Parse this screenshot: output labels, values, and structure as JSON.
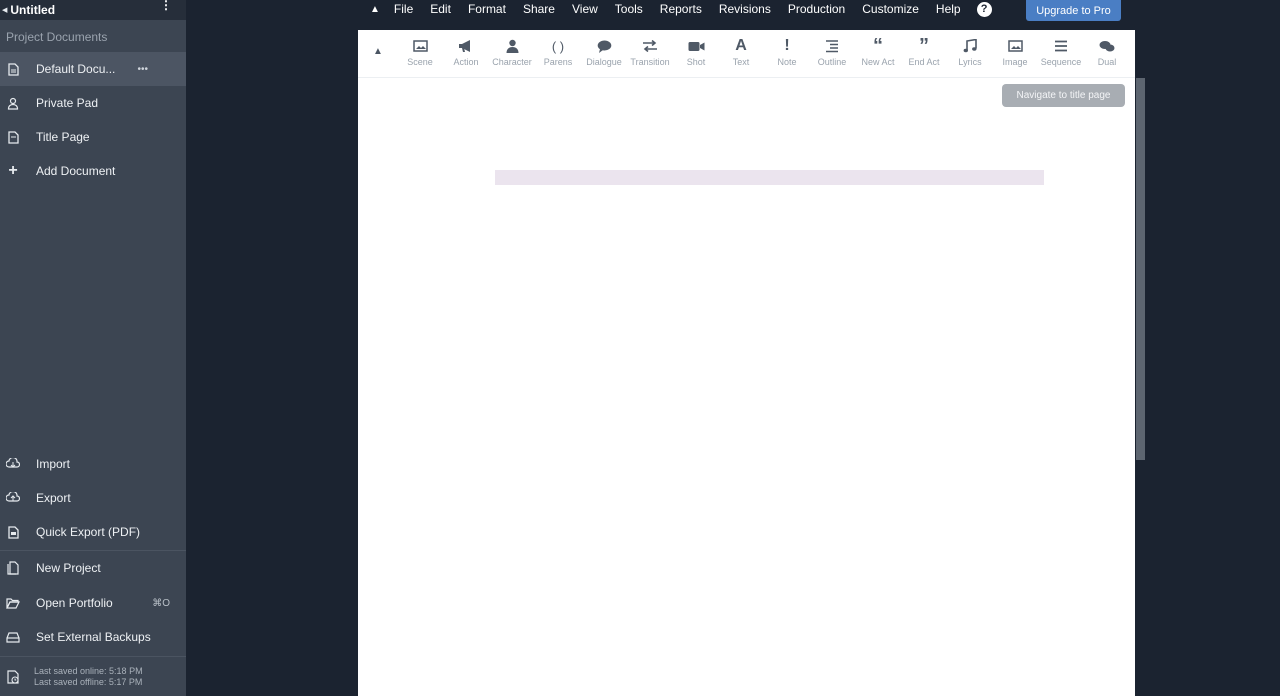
{
  "sidebar": {
    "project_title": "Untitled",
    "section_label": "Project Documents",
    "documents": [
      {
        "label": "Default Docu...",
        "icon": "document-icon",
        "extra": "•••",
        "active": true
      },
      {
        "label": "Private Pad",
        "icon": "private-pad-icon"
      },
      {
        "label": "Title Page",
        "icon": "title-page-icon"
      },
      {
        "label": "Add Document",
        "icon": "plus-icon"
      }
    ],
    "actions": [
      {
        "label": "Import",
        "icon": "import-icon"
      },
      {
        "label": "Export",
        "icon": "export-icon"
      },
      {
        "label": "Quick Export (PDF)",
        "icon": "pdf-icon"
      },
      {
        "label": "New Project",
        "icon": "new-project-icon"
      },
      {
        "label": "Open Portfolio",
        "icon": "folder-icon",
        "shortcut": "⌘O"
      },
      {
        "label": "Set External Backups",
        "icon": "backup-icon"
      }
    ],
    "footer": {
      "saved_online": "Last saved online: 5:18 PM",
      "saved_offline": "Last saved offline: 5:17 PM"
    }
  },
  "menubar": {
    "items": [
      "File",
      "Edit",
      "Format",
      "Share",
      "View",
      "Tools",
      "Reports",
      "Revisions",
      "Production",
      "Customize",
      "Help"
    ],
    "upgrade_label": "Upgrade to Pro"
  },
  "toolbar": {
    "buttons": [
      {
        "label": "Scene",
        "icon": "image-icon"
      },
      {
        "label": "Action",
        "icon": "megaphone-icon"
      },
      {
        "label": "Character",
        "icon": "person-icon"
      },
      {
        "label": "Parens",
        "icon": "parens-icon"
      },
      {
        "label": "Dialogue",
        "icon": "speech-bubble-icon"
      },
      {
        "label": "Transition",
        "icon": "arrows-icon"
      },
      {
        "label": "Shot",
        "icon": "camera-icon"
      },
      {
        "label": "Text",
        "icon": "text-icon"
      },
      {
        "label": "Note",
        "icon": "exclamation-icon"
      },
      {
        "label": "Outline",
        "icon": "outline-icon"
      },
      {
        "label": "New Act",
        "icon": "open-quote-icon"
      },
      {
        "label": "End Act",
        "icon": "close-quote-icon"
      },
      {
        "label": "Lyrics",
        "icon": "music-icon"
      },
      {
        "label": "Image",
        "icon": "picture-icon"
      },
      {
        "label": "Sequence",
        "icon": "list-icon"
      },
      {
        "label": "Dual",
        "icon": "chat-icon"
      }
    ]
  },
  "tooltip": "Navigate to title page"
}
